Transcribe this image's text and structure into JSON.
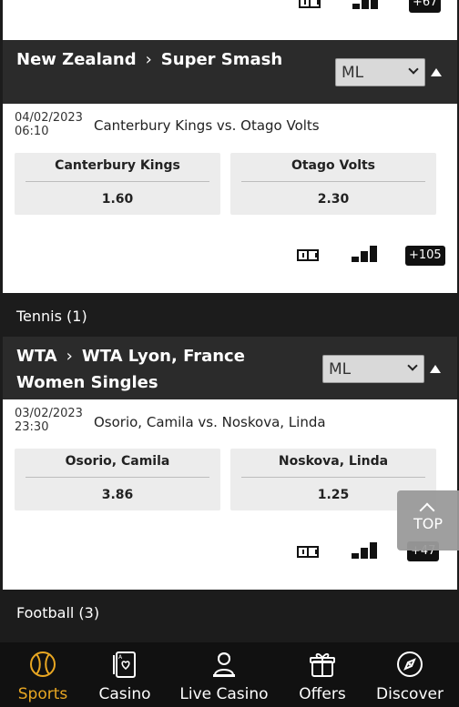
{
  "colors": {
    "accent": "#e9a722",
    "header_bg": "#2b2b2b",
    "sport_bar_bg": "#1c1c1c",
    "odds_bg": "#ececec",
    "nav_bg": "#111111"
  },
  "top_partial": {
    "more_count": "+67"
  },
  "league1": {
    "country": "New Zealand",
    "competition": "Super Smash",
    "market_select": "ML",
    "match": {
      "date": "04/02/2023",
      "time": "06:10",
      "title": "Canterbury Kings vs. Otago Volts",
      "home": {
        "name": "Canterbury Kings",
        "odds": "1.60"
      },
      "away": {
        "name": "Otago Volts",
        "odds": "2.30"
      },
      "more_count": "+105"
    }
  },
  "sport_tennis": {
    "label": "Tennis (1)"
  },
  "league2": {
    "country": "WTA",
    "competition": "WTA Lyon, France Women Singles",
    "market_select": "ML",
    "match": {
      "date": "03/02/2023",
      "time": "23:30",
      "title": "Osorio, Camila vs. Noskova, Linda",
      "home": {
        "name": "Osorio, Camila",
        "odds": "3.86"
      },
      "away": {
        "name": "Noskova, Linda",
        "odds": "1.25"
      },
      "more_count": "+47"
    }
  },
  "sport_football": {
    "label": "Football (3)"
  },
  "top_button": {
    "label": "TOP"
  },
  "nav": {
    "items": [
      {
        "label": "Sports",
        "icon": "sports-ball-icon"
      },
      {
        "label": "Casino",
        "icon": "casino-cards-icon"
      },
      {
        "label": "Live Casino",
        "icon": "live-dealer-icon"
      },
      {
        "label": "Offers",
        "icon": "gift-offers-icon"
      },
      {
        "label": "Discover",
        "icon": "compass-icon"
      }
    ]
  }
}
